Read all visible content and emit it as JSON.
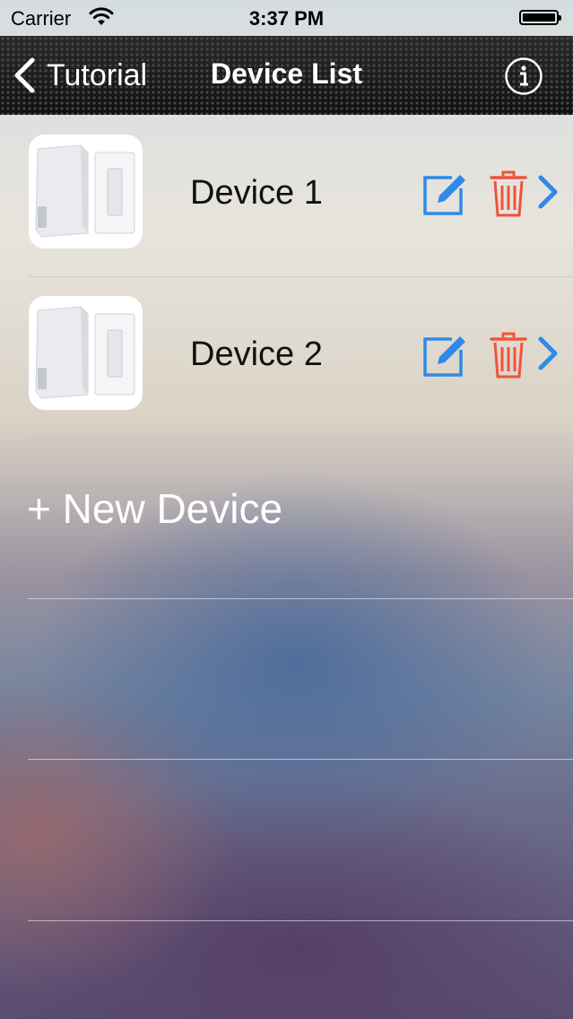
{
  "status_bar": {
    "carrier": "Carrier",
    "time": "3:37 PM"
  },
  "nav": {
    "back_label": "Tutorial",
    "title": "Device List",
    "info_icon": "info-icon"
  },
  "devices": [
    {
      "name": "Device 1"
    },
    {
      "name": "Device 2"
    }
  ],
  "new_device_label": "+ New Device",
  "colors": {
    "accent_blue": "#2e8ae6",
    "delete_red": "#f0533b",
    "nav_bar": "#1f1f1f"
  }
}
